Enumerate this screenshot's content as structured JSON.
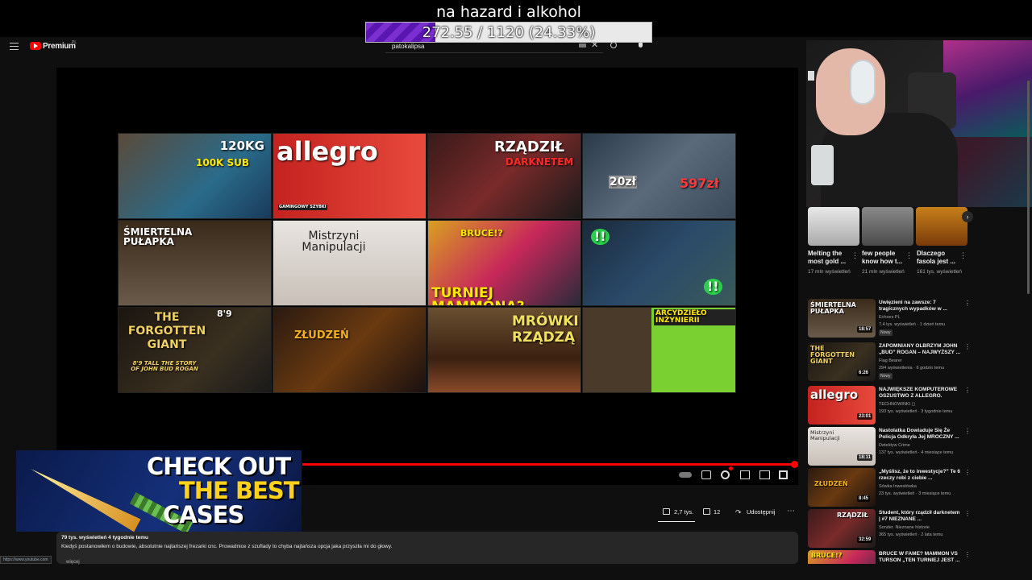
{
  "overlay": {
    "title": "na hazard i alkohol",
    "progress_label": "272.55 / 1120 (24.33%)",
    "progress_fraction": 0.2433,
    "progress_color": "#7b2fd1"
  },
  "header": {
    "brand": "Premium",
    "brand_sup": "PL",
    "search_query": "patokalipsa"
  },
  "thumbnails": [
    {
      "text": "120KG",
      "text2": "100K SUB"
    },
    {
      "text": "allegro",
      "text2": "GAMINGOWY SZYBKI"
    },
    {
      "text": "RZĄDZIŁ",
      "text2": "DARKNETEM"
    },
    {
      "text": "20zł",
      "text2": "597zł"
    },
    {
      "text": "ŚMIERTELNA PUŁAPKA",
      "text2": ""
    },
    {
      "text": "Mistrzyni Manipulacji",
      "text2": ""
    },
    {
      "text": "BRUCE!?",
      "text2": "TURNIEJ MAMMONA?"
    },
    {
      "text": "!!",
      "text2": "!!"
    },
    {
      "text": "THE FORGOTTEN GIANT",
      "text2": "8'9 TALL THE STORY OF JOHN BUD ROGAN",
      "text3": "8'9"
    },
    {
      "text": "ZŁUDZEŃ",
      "text2": ""
    },
    {
      "text": "MRÓWKI RZĄDZĄ",
      "text2": ""
    },
    {
      "text": "ARCYDZIEŁO INŻYNIERII",
      "text2": ""
    }
  ],
  "ad": {
    "line1": "CHECK OUT",
    "line2": "THE BEST",
    "line3": "CASES"
  },
  "actions": {
    "likes": "2,7 tys.",
    "dislikes": "12",
    "share": "Udostępnij"
  },
  "description": {
    "meta": "79 tys. wyświetleń  4 tygodnie temu",
    "body": "Kiedyś postanowiłem o budowie, absolutnie najtańszej frezarki cnc. Prowadnice z szuflady to chyba najtańsza opcja jaka przyszła mi do głowy.",
    "more": "więcej",
    "url_tip": "https://www.youtube.com"
  },
  "shorts": [
    {
      "title": "Melting the most gold ...",
      "views": "17 mln wyświetleń"
    },
    {
      "title": "few people know how t...",
      "views": "21 mln wyświetleń"
    },
    {
      "title": "Dlaczego fasola jest ...",
      "views": "161 tys. wyświetleń"
    }
  ],
  "recommendations": [
    {
      "title": "Uwięzieni na zawsze: 7 tragicznych wypadków w ...",
      "channel": "Echoes PL",
      "views": "7,4 tys. wyświetleń  ·  1 dzień temu",
      "badge": "Nowy",
      "duration": "18:57",
      "thumb_text": "ŚMIERTELNA PUŁAPKA"
    },
    {
      "title": "ZAPOMNIANY OLBRZYM JOHN „BUD” ROGAN – NAJWYŻSZY ...",
      "channel": "Flag Bearer",
      "views": "294 wyświetlenia  ·  6 godzin temu",
      "badge": "Nowy",
      "duration": "6:26",
      "thumb_text": "THE FORGOTTEN GIANT"
    },
    {
      "title": "NAJWIĘKSZE KOMPUTEROWE OSZUSTWO Z ALLEGRO.",
      "channel": "TECHNOWINKI ◻",
      "views": "193 tys. wyświetleń  ·  3 tygodnie temu",
      "badge": "",
      "duration": "23:01",
      "thumb_text": "allegro"
    },
    {
      "title": "Nastolatka Dowiaduje Się Że Policja Odkryła Jej MROCZNY ...",
      "channel": "Detektyw Crime",
      "views": "137 tys. wyświetleń  ·  4 miesiące temu",
      "badge": "",
      "duration": "18:11",
      "thumb_text": "Mistrzyni Manipulacji"
    },
    {
      "title": "„Myślisz, że to inwestycje?” Te 6 rzeczy robi z ciebie ...",
      "channel": "Sówka Inwestówka",
      "views": "23 tys. wyświetleń  ·  3 miesiące temu",
      "badge": "",
      "duration": "8:45",
      "thumb_text": "ZŁUDZEŃ"
    },
    {
      "title": "Student, który rządził darknetem | #7 NIEZNANE ...",
      "channel": "Sonder. Nieznane historie",
      "views": "365 tys. wyświetleń  ·  2 lata temu",
      "badge": "",
      "duration": "32:59",
      "thumb_text": "RZĄDZIŁ"
    },
    {
      "title": "BRUCE W FAME? MAMMON VS TURSON „TEN TURNIEJ JEST ...",
      "channel": "",
      "views": "",
      "badge": "",
      "duration": "",
      "thumb_text": "BRUCE!?"
    }
  ],
  "colors": {
    "background": "#0f0f0f",
    "accent_red": "#ff0000",
    "ad_yellow": "#ffd21a"
  }
}
